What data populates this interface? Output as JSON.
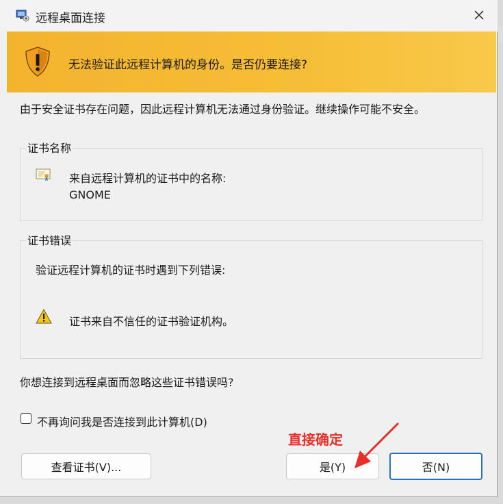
{
  "window": {
    "title": "远程桌面连接",
    "close_glyph": "✕"
  },
  "banner": {
    "message": "无法验证此远程计算机的身份。是否仍要连接?"
  },
  "description": "由于安全证书存在问题，因此远程计算机无法通过身份验证。继续操作可能不安全。",
  "cert_name_group": {
    "label": "证书名称",
    "line1": "来自远程计算机的证书中的名称:",
    "line2": "GNOME"
  },
  "cert_errors_group": {
    "label": "证书错误",
    "intro": "验证远程计算机的证书时遇到下列错误:",
    "error_item": "证书来自不信任的证书验证机构。"
  },
  "question": "你想连接到远程桌面而忽略这些证书错误吗?",
  "checkbox": {
    "label": "不再询问我是否连接到此计算机(D)",
    "checked": false
  },
  "buttons": {
    "view_cert": "查看证书(V)...",
    "yes": "是(Y)",
    "no": "否(N)"
  },
  "annotation": {
    "text": "直接确定",
    "color": "#e8302a"
  },
  "colors": {
    "banner": "#f6be36",
    "primary_border": "#2a6fbf"
  }
}
